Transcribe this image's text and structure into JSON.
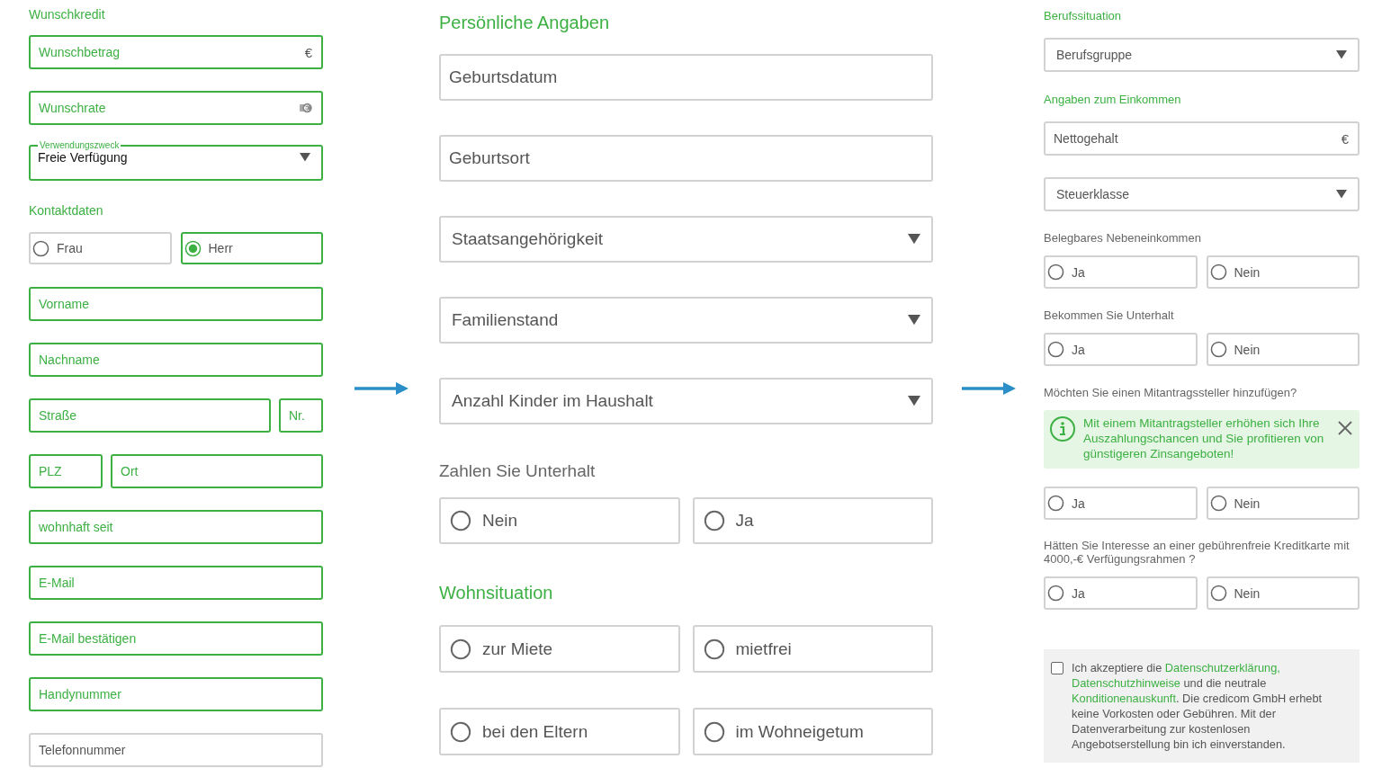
{
  "credit": {
    "heading": "Wunschkredit",
    "fields": [
      {
        "kind": "input",
        "placeholder": "Wunschbetrag",
        "suffix": "€",
        "valid": true
      },
      {
        "kind": "input",
        "placeholder": "Wunschrate",
        "valid": true
      },
      {
        "kind": "select",
        "label": "Verwendungszweck",
        "value": "Freie Verfügung",
        "valid": true
      }
    ]
  },
  "contact": {
    "heading": "Kontaktdaten",
    "salutation": [
      {
        "label": "Frau",
        "selected": false
      },
      {
        "label": "Herr",
        "selected": true
      }
    ],
    "rows": [
      [
        {
          "placeholder": "Vorname",
          "valid": true
        }
      ],
      [
        {
          "placeholder": "Nachname",
          "valid": true
        }
      ],
      [
        {
          "placeholder": "Straße",
          "valid": true
        },
        {
          "placeholder": "Nr.",
          "valid": true
        }
      ],
      [
        {
          "placeholder": "PLZ",
          "valid": true
        },
        {
          "placeholder": "Ort",
          "valid": true
        }
      ],
      [
        {
          "placeholder": "wohnhaft seit",
          "valid": true
        }
      ],
      [
        {
          "placeholder": "E-Mail",
          "valid": true
        }
      ],
      [
        {
          "placeholder": "E-Mail bestätigen",
          "valid": true
        }
      ],
      [
        {
          "placeholder": "Handynummer",
          "valid": true
        }
      ],
      [
        {
          "placeholder": "Telefonnummer",
          "valid": false
        }
      ]
    ]
  },
  "personal": {
    "heading": "Persönliche Angaben",
    "fields": [
      {
        "kind": "input",
        "placeholder": "Geburtsdatum"
      },
      {
        "kind": "input",
        "placeholder": "Geburtsort"
      },
      {
        "kind": "select",
        "placeholder": "Staatsangehörigkeit"
      },
      {
        "kind": "select",
        "placeholder": "Familienstand"
      },
      {
        "kind": "select",
        "placeholder": "Anzahl Kinder im Haushalt"
      }
    ],
    "support_question": "Zahlen Sie Unterhalt",
    "support_options": [
      {
        "label": "Nein",
        "selected": false
      },
      {
        "label": "Ja",
        "selected": false
      }
    ],
    "housing_heading": "Wohnsituation",
    "housing_options": [
      [
        {
          "label": "zur Miete",
          "selected": false
        },
        {
          "label": "mietfrei",
          "selected": false
        }
      ],
      [
        {
          "label": "bei den Eltern",
          "selected": false
        },
        {
          "label": "im Wohneigetum",
          "selected": false
        }
      ]
    ]
  },
  "job": {
    "items": [
      {
        "kind": "heading",
        "text": "Berufssituation"
      },
      {
        "kind": "select",
        "placeholder": "Berufsgruppe"
      },
      {
        "kind": "heading",
        "text": "Angaben zum Einkommen"
      },
      {
        "kind": "input",
        "placeholder": "Nettogehalt",
        "suffix": "€"
      },
      {
        "kind": "select",
        "placeholder": "Steuerklasse"
      },
      {
        "kind": "question",
        "text": "Belegbares Nebeneinkommen"
      },
      {
        "kind": "radios",
        "options": [
          {
            "label": "Ja",
            "selected": false
          },
          {
            "label": "Nein",
            "selected": false
          }
        ]
      },
      {
        "kind": "question",
        "text": "Bekommen Sie Unterhalt"
      },
      {
        "kind": "radios",
        "options": [
          {
            "label": "Ja",
            "selected": false
          },
          {
            "label": "Nein",
            "selected": false
          }
        ]
      },
      {
        "kind": "question",
        "text": "Möchten Sie einen Mitantragssteller hinzufügen?"
      },
      {
        "kind": "info",
        "text": "Mit einem Mitantragsteller erhöhen sich Ihre Auszahlungschancen und Sie profitieren von günstigeren Zinsangeboten!"
      },
      {
        "kind": "radios",
        "options": [
          {
            "label": "Ja",
            "selected": false
          },
          {
            "label": "Nein",
            "selected": false
          }
        ]
      },
      {
        "kind": "question",
        "text": "Hätten Sie Interesse an einer gebührenfreie Kreditkarte mit 4000,-€ Verfügungsrahmen ?"
      },
      {
        "kind": "radios",
        "options": [
          {
            "label": "Ja",
            "selected": false
          },
          {
            "label": "Nein",
            "selected": false
          }
        ]
      }
    ]
  },
  "consent": {
    "checked": false,
    "parts": [
      {
        "text": "Ich akzeptiere die ",
        "link": false
      },
      {
        "text": "Datenschutzerklärung,",
        "link": true
      },
      {
        "text": "Datenschutzhinweise",
        "link": true
      },
      {
        "text": " und die neutrale ",
        "link": false
      },
      {
        "text": "Konditionenauskunft",
        "link": true
      },
      {
        "text": ". Die credicom GmbH erhebt keine Vorkosten oder Gebühren. Mit der Datenverarbeitung zur kostenlosen Angebotserstellung bin ich einverstanden.",
        "link": false
      }
    ]
  }
}
